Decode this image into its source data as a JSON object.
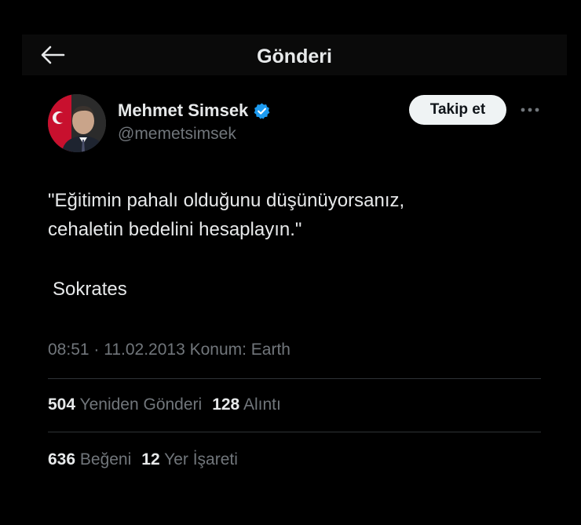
{
  "header": {
    "title": "Gönderi",
    "back_icon": "arrow-left-icon"
  },
  "user": {
    "display_name": "Mehmet Simsek",
    "handle": "@memetsimsek",
    "verified_icon": "verified-badge-icon",
    "verified_color": "#1d9bf0"
  },
  "actions": {
    "follow_label": "Takip et",
    "more_icon": "more-horizontal-icon"
  },
  "tweet": {
    "line1": "\"Eğitimin pahalı olduğunu düşünüyorsanız,",
    "line2": "cehaletin bedelini hesaplayın.\"",
    "author": "Sokrates"
  },
  "meta": {
    "text": "08:51 · 11.02.2013 Konum: Earth"
  },
  "stats": {
    "reposts_count": "504",
    "reposts_label": "Yeniden Gönderi",
    "quotes_count": "128",
    "quotes_label": "Alıntı",
    "likes_count": "636",
    "likes_label": "Beğeni",
    "bookmarks_count": "12",
    "bookmarks_label": "Yer İşareti"
  },
  "colors": {
    "background": "#000000",
    "text_primary": "#e7e9ea",
    "text_secondary": "#71767b",
    "follow_button_bg": "#eff3f4"
  }
}
